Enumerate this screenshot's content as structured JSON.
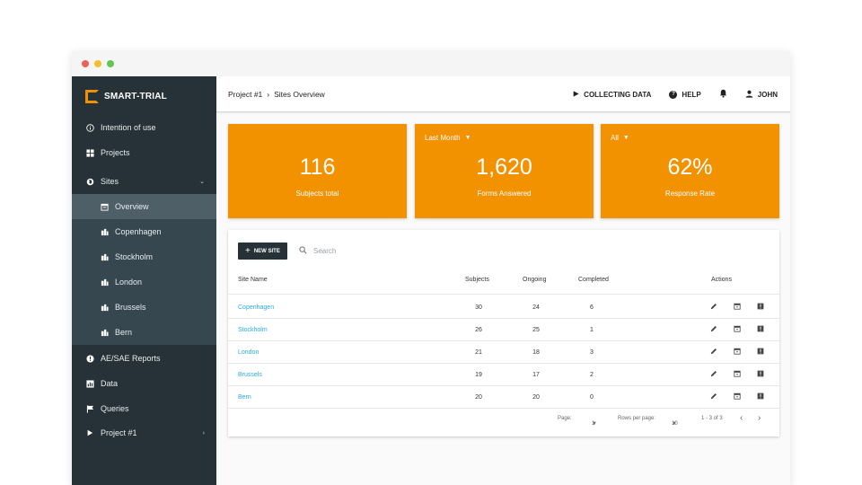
{
  "sidebar": {
    "logo_text": "SMART-TRIAL",
    "items": [
      {
        "label": "Intention of use",
        "icon": "info-icon"
      },
      {
        "label": "Projects",
        "icon": "grid-icon"
      },
      {
        "label": "Sites",
        "icon": "globe-icon"
      },
      {
        "label": "Overview",
        "icon": "calendar-icon"
      },
      {
        "label": "Copenhagen",
        "icon": "building-icon"
      },
      {
        "label": "Stockholm",
        "icon": "building-icon"
      },
      {
        "label": "London",
        "icon": "building-icon"
      },
      {
        "label": "Brussels",
        "icon": "building-icon"
      },
      {
        "label": "Bern",
        "icon": "building-icon"
      },
      {
        "label": "AE/SAE Reports",
        "icon": "alert-icon"
      },
      {
        "label": "Data",
        "icon": "chart-icon"
      },
      {
        "label": "Queries",
        "icon": "flag-icon"
      },
      {
        "label": "Project #1",
        "icon": "play-icon"
      }
    ]
  },
  "topbar": {
    "breadcrumb_project": "Project #1",
    "breadcrumb_sep": "›",
    "breadcrumb_page": "Sites Overview",
    "collecting": "COLLECTING DATA",
    "help": "HELP",
    "user": "JOHN"
  },
  "cards": [
    {
      "filter": "",
      "value": "116",
      "label": "Subjects total"
    },
    {
      "filter": "Last Month",
      "value": "1,620",
      "label": "Forms Answered"
    },
    {
      "filter": "All",
      "value": "62%",
      "label": "Response Rate"
    }
  ],
  "table": {
    "new_site_label": "NEW SITE",
    "search_placeholder": "Search",
    "headers": {
      "site": "Site Name",
      "subjects": "Subjects",
      "ongoing": "Ongoing",
      "completed": "Completed",
      "actions": "Actions"
    },
    "rows": [
      {
        "site": "Copenhagen",
        "subjects": "30",
        "ongoing": "24",
        "completed": "6"
      },
      {
        "site": "Stockholm",
        "subjects": "26",
        "ongoing": "25",
        "completed": "1"
      },
      {
        "site": "London",
        "subjects": "21",
        "ongoing": "18",
        "completed": "3"
      },
      {
        "site": "Brussels",
        "subjects": "19",
        "ongoing": "17",
        "completed": "2"
      },
      {
        "site": "Bern",
        "subjects": "20",
        "ongoing": "20",
        "completed": "0"
      }
    ],
    "pager": {
      "page_label": "Page:",
      "page_value": "1",
      "rows_label": "Rows per page:",
      "rows_value": "10",
      "range": "1 - 3 of 3"
    }
  },
  "colors": {
    "accent": "#f39200",
    "sidebar": "#263238",
    "link": "#29abe2"
  }
}
